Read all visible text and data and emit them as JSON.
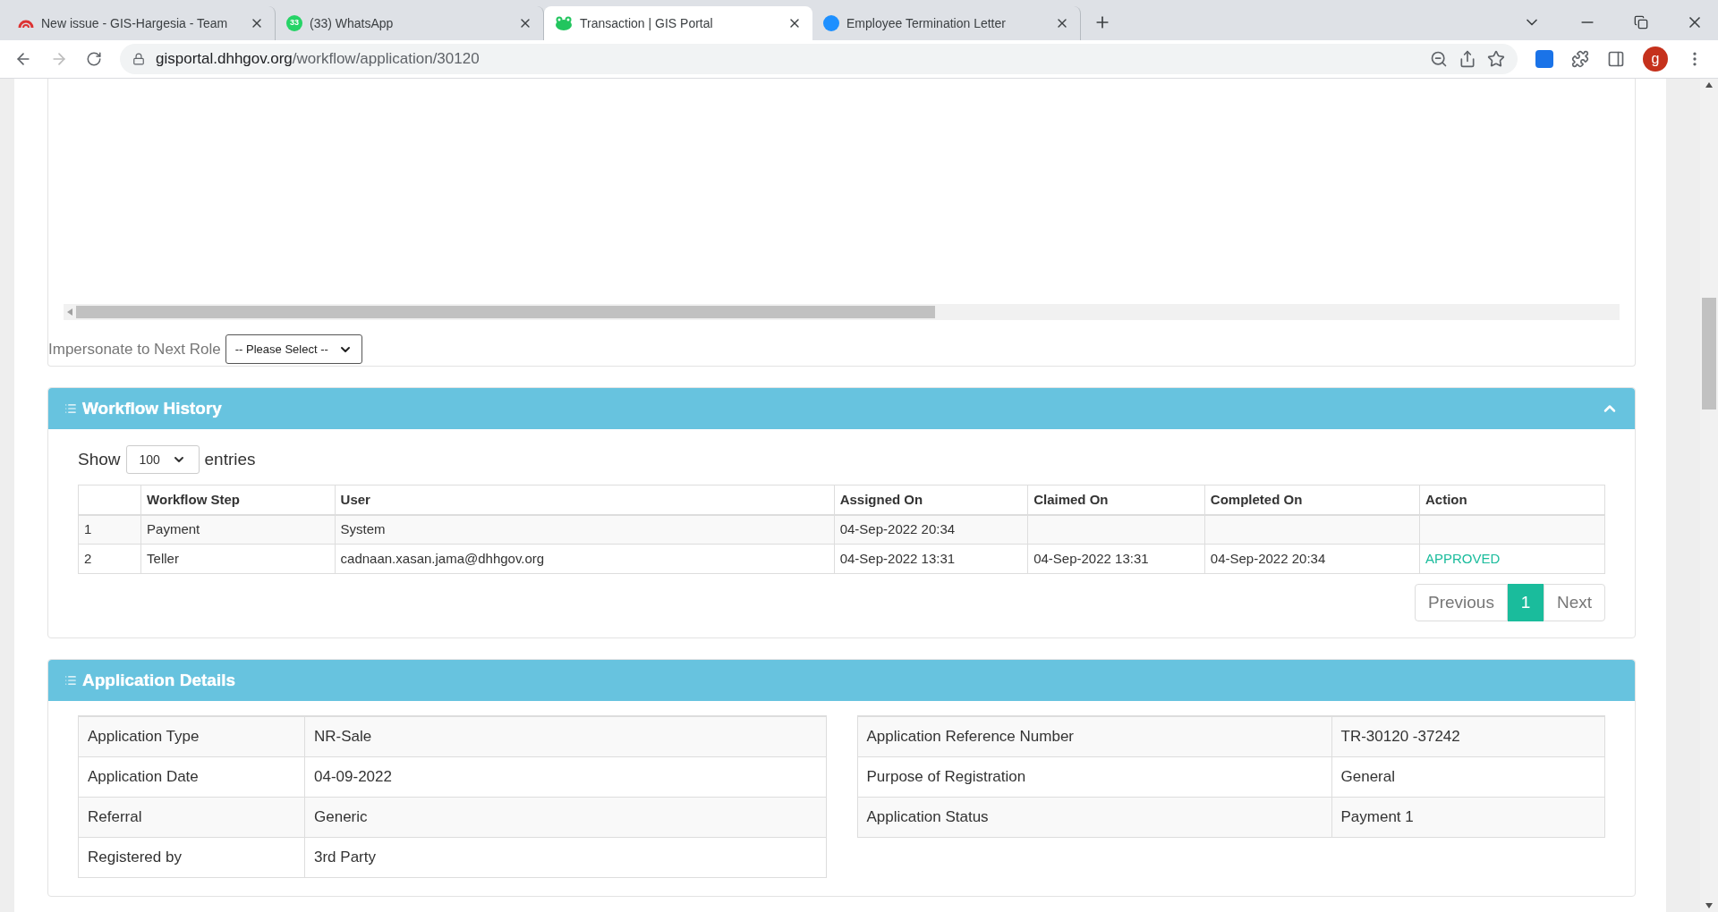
{
  "browser": {
    "tabs": [
      {
        "title": "New issue - GIS-Hargesia - Team",
        "selected": false,
        "kind": "rainbow"
      },
      {
        "title": "(33) WhatsApp",
        "selected": false,
        "kind": "whatsapp",
        "badge": "33"
      },
      {
        "title": "Transaction | GIS Portal",
        "selected": true,
        "kind": "portal"
      },
      {
        "title": "Employee Termination Letter",
        "selected": false,
        "kind": "letter"
      }
    ],
    "url_host": "gisportal.dhhgov.org",
    "url_path": "/workflow/application/30120",
    "profile_initial": "g"
  },
  "impersonate": {
    "label": "Impersonate to Next Role",
    "select_value": "-- Please Select --"
  },
  "workflow_history": {
    "title": "Workflow History",
    "expanded": true,
    "show_label": "Show",
    "page_size": "100",
    "entries_label": "entries",
    "columns": [
      "",
      "Workflow Step",
      "User",
      "Assigned On",
      "Claimed On",
      "Completed On",
      "Action"
    ],
    "rows": [
      [
        "1",
        "Payment",
        "System",
        "04-Sep-2022 20:34",
        "",
        "",
        ""
      ],
      [
        "2",
        "Teller",
        "cadnaan.xasan.jama@dhhgov.org",
        "04-Sep-2022 13:31",
        "04-Sep-2022 13:31",
        "04-Sep-2022 20:34",
        "APPROVED"
      ]
    ],
    "pagination": {
      "previous": "Previous",
      "pages": [
        {
          "label": "1",
          "selected": true
        }
      ],
      "next": "Next"
    }
  },
  "application_details": {
    "title": "Application Details",
    "left": [
      [
        "Application Type",
        "NR-Sale"
      ],
      [
        "Application Date",
        "04-09-2022"
      ],
      [
        "Referral",
        "Generic"
      ],
      [
        "Registered by",
        "3rd Party"
      ]
    ],
    "right": [
      [
        "Application Reference Number",
        "TR-30120 -37242"
      ],
      [
        "Purpose of Registration",
        "General"
      ],
      [
        "Application Status",
        "Payment 1"
      ]
    ]
  }
}
